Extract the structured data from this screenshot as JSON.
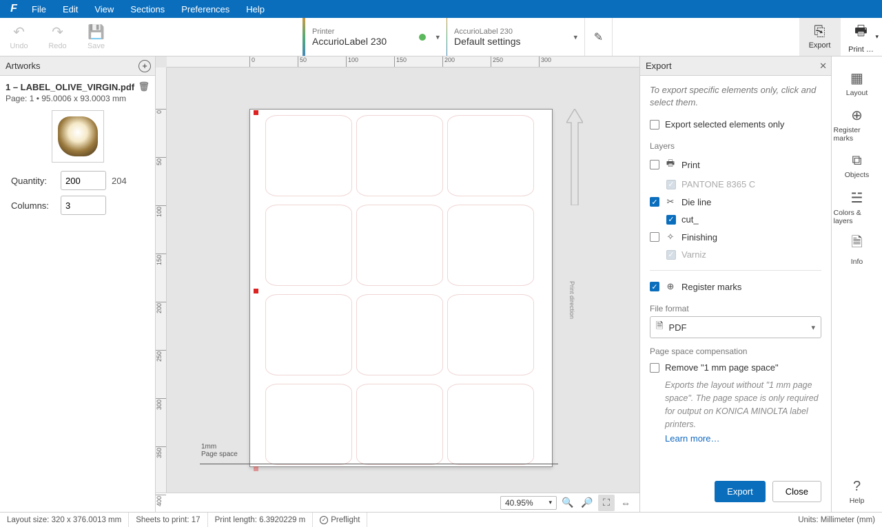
{
  "menubar": {
    "items": [
      "File",
      "Edit",
      "View",
      "Sections",
      "Preferences",
      "Help"
    ]
  },
  "toolbar": {
    "undo": "Undo",
    "redo": "Redo",
    "save": "Save",
    "printer_label": "Printer",
    "printer_value": "AccurioLabel 230",
    "settings_label": "AccurioLabel 230",
    "settings_value": "Default settings",
    "export": "Export",
    "print": "Print …"
  },
  "artworks": {
    "header": "Artworks",
    "item": {
      "title": "1 – LABEL_OLIVE_VIRGIN.pdf",
      "subtitle": "Page: 1 • 95.0006 x 93.0003 mm",
      "quantity_label": "Quantity:",
      "quantity_value": "200",
      "quantity_total": "204",
      "columns_label": "Columns:",
      "columns_value": "3"
    }
  },
  "canvas": {
    "page_space_line1": "1mm",
    "page_space_line2": "Page space",
    "print_direction": "Print direction"
  },
  "zoom": {
    "value": "40.95%"
  },
  "export_panel": {
    "header": "Export",
    "hint": "To export specific elements only, click and select them.",
    "export_selected": "Export selected elements only",
    "layers_title": "Layers",
    "layer_print": "Print",
    "layer_print_sub": "PANTONE 8365 C",
    "layer_die": "Die line",
    "layer_die_sub": "cut_",
    "layer_fin": "Finishing",
    "layer_fin_sub": "Varniz",
    "layer_reg": "Register marks",
    "file_format_title": "File format",
    "file_format_value": "PDF",
    "page_comp_title": "Page space compensation",
    "page_comp_check": "Remove \"1 mm page space\"",
    "page_comp_desc": "Exports the layout without \"1 mm page space\". The page space is only required for output on KONICA MINOLTA label printers.",
    "learn_more": "Learn more…",
    "export_btn": "Export",
    "close_btn": "Close"
  },
  "rail": {
    "layout": "Layout",
    "register": "Register marks",
    "objects": "Objects",
    "colors": "Colors & layers",
    "info": "Info",
    "help": "Help"
  },
  "statusbar": {
    "layout_size": "Layout size: 320 x 376.0013 mm",
    "sheets": "Sheets to print: 17",
    "print_length": "Print length: 6.3920229 m",
    "preflight": "Preflight",
    "units": "Units: Millimeter (mm)"
  },
  "ruler_h": [
    0,
    50,
    100,
    150,
    200,
    250,
    300
  ],
  "ruler_v": [
    0,
    50,
    100,
    150,
    200,
    250,
    300,
    350,
    400
  ]
}
